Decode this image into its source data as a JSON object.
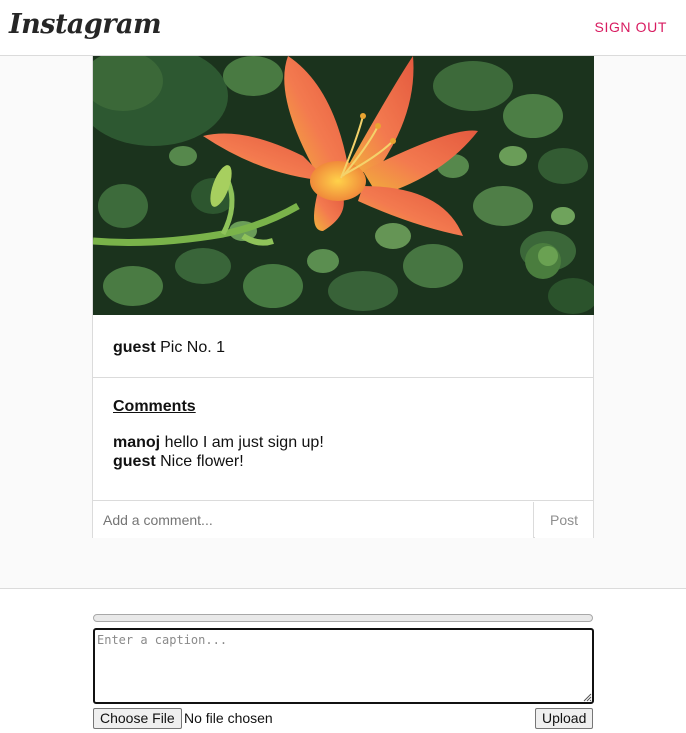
{
  "header": {
    "logo_text": "Instagram",
    "signout_label": "SIGN OUT"
  },
  "post": {
    "image_icon": "lily-flower-photo",
    "caption": {
      "username": "guest",
      "text": "Pic No. 1"
    },
    "comments_heading": "Comments",
    "comments": [
      {
        "username": "manoj",
        "text": "hello I am just sign up!"
      },
      {
        "username": "guest",
        "text": "Nice flower!"
      }
    ],
    "add_comment_placeholder": "Add a comment...",
    "post_button_label": "Post"
  },
  "upload": {
    "progress": 0,
    "caption_placeholder": "Enter a caption...",
    "choose_file_label": "Choose File",
    "file_status": "No file chosen",
    "upload_button_label": "Upload"
  },
  "colors": {
    "accent": "#d81b60",
    "border": "#dbdbdb",
    "page_bg": "#fafafa"
  }
}
